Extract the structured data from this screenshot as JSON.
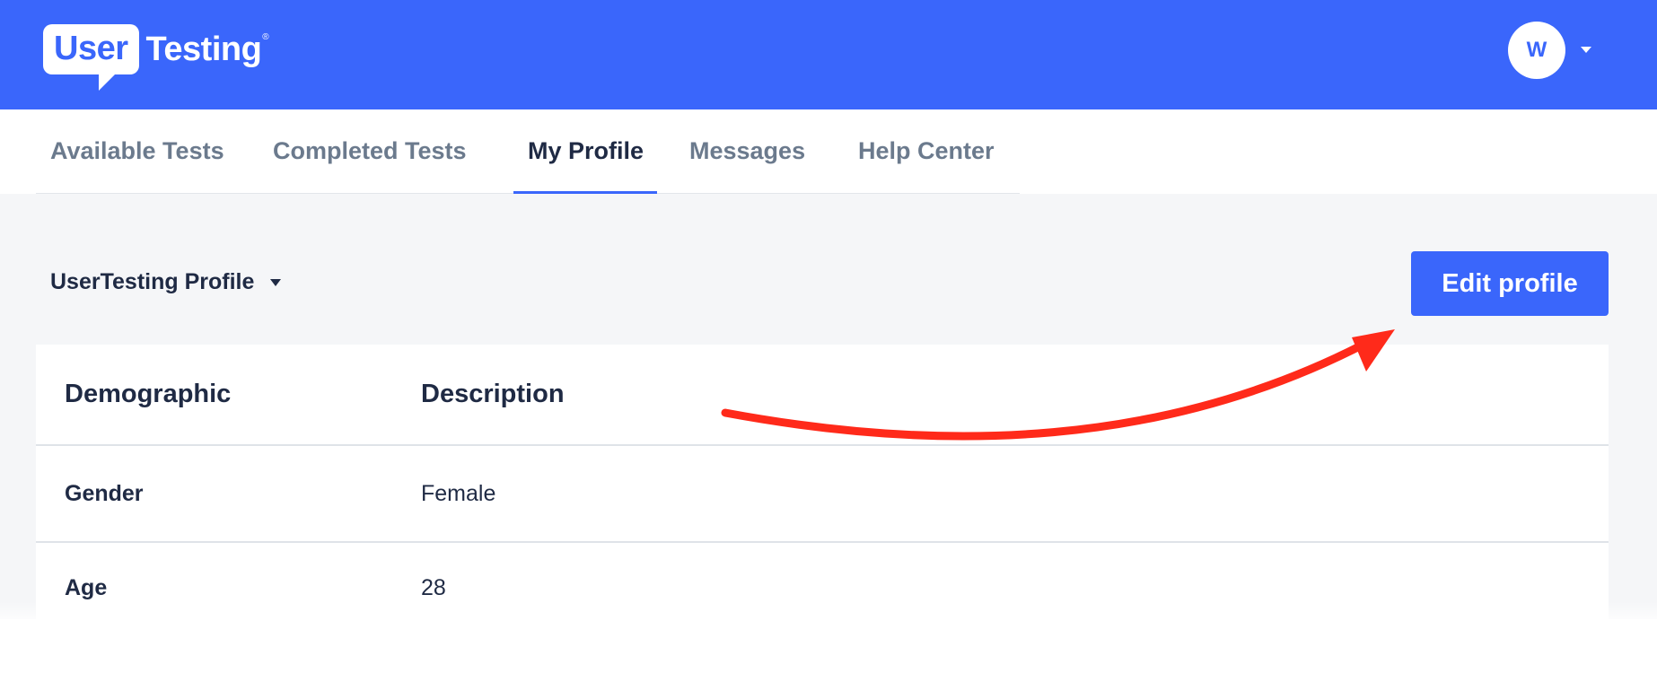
{
  "header": {
    "logo_bubble_text": "User",
    "logo_word_text": "Testing",
    "logo_reg": "®",
    "avatar_initial": "W",
    "brand_color": "#3a66fb"
  },
  "tabs": [
    {
      "label": "Available Tests",
      "active": false
    },
    {
      "label": "Completed Tests",
      "active": false
    },
    {
      "label": "My Profile",
      "active": true
    },
    {
      "label": "Messages",
      "active": false
    },
    {
      "label": "Help Center",
      "active": false
    }
  ],
  "profile": {
    "selector_label": "UserTesting Profile",
    "edit_button_label": "Edit profile"
  },
  "table": {
    "headers": [
      "Demographic",
      "Description"
    ],
    "rows": [
      {
        "label": "Gender",
        "value": "Female"
      },
      {
        "label": "Age",
        "value": "28"
      }
    ]
  },
  "annotation": {
    "arrow_color": "#ff2a1a",
    "arrow_target": "edit-profile-button"
  },
  "icons": {
    "avatar_caret": "caret-down-icon",
    "selector_caret": "caret-down-icon"
  }
}
